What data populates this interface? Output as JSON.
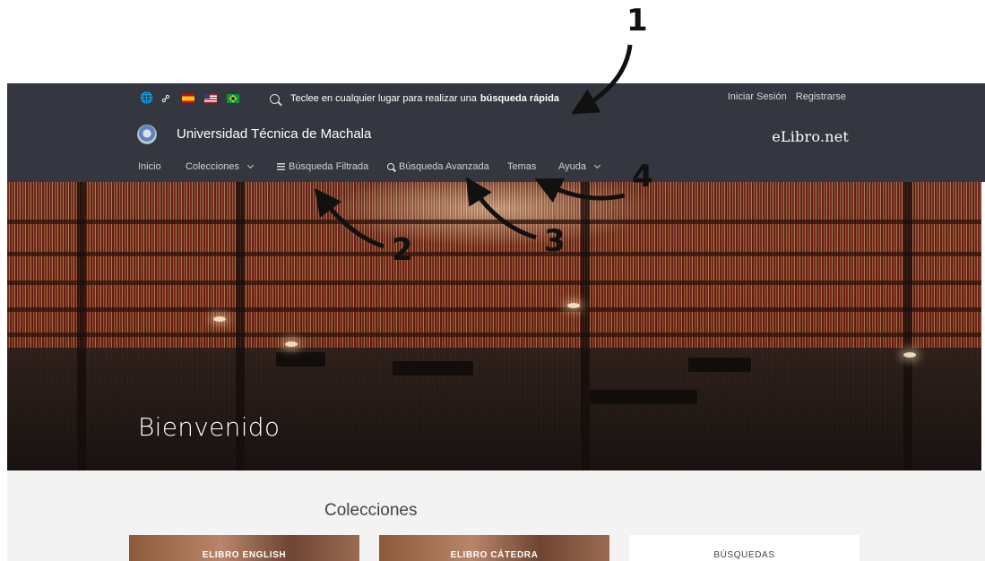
{
  "annotations": [
    "1",
    "2",
    "3",
    "4"
  ],
  "header": {
    "quick_search_prefix": "Teclee en cualquier lugar para realizar una",
    "quick_search_bold": "búsqueda rápida",
    "login": "Iniciar Sesión",
    "register": "Registrarse",
    "university": "Universidad Técnica de Machala",
    "brand": "eLibro.net",
    "background_color": "#34373f"
  },
  "nav": {
    "inicio": "Inicio",
    "colecciones": "Colecciones",
    "busqueda_filtrada": "Búsqueda Filtrada",
    "busqueda_avanzada": "Búsqueda Avanzada",
    "temas": "Temas",
    "ayuda": "Ayuda"
  },
  "hero": {
    "welcome": "Bienvenido"
  },
  "collections": {
    "title": "Colecciones",
    "cards": [
      "ELIBRO ENGLISH",
      "ELIBRO CÁTEDRA",
      "BÚSQUEDAS"
    ]
  },
  "icons": [
    "globe-icon",
    "link-icon",
    "flag-es-icon",
    "flag-us-icon",
    "flag-br-icon",
    "search-icon",
    "filter-icon",
    "chevron-down-icon"
  ]
}
